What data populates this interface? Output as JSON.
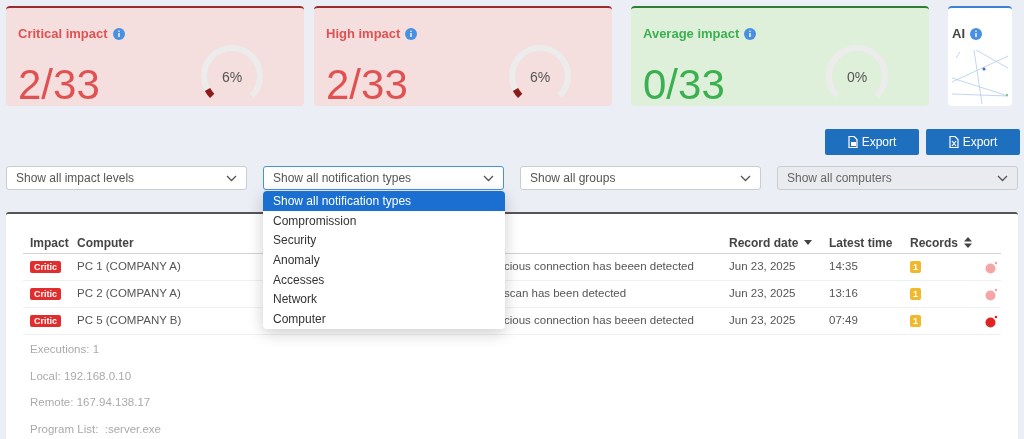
{
  "cards": [
    {
      "kind": "critical",
      "title": "Critical impact",
      "value": "2/33",
      "percent": "6%",
      "level": 0.06
    },
    {
      "kind": "high",
      "title": "High impact",
      "value": "2/33",
      "percent": "6%",
      "level": 0.06
    },
    {
      "kind": "average",
      "title": "Average impact",
      "value": "0/33",
      "percent": "0%"
    },
    {
      "kind": "ai",
      "title": "AI"
    }
  ],
  "export_buttons": [
    {
      "kind": "pdf",
      "label": "Export"
    },
    {
      "kind": "excel",
      "label": "Export"
    }
  ],
  "filters": [
    {
      "value": "Show all impact levels",
      "disabled": false,
      "expanded": false
    },
    {
      "value": "Show all notification types",
      "disabled": false,
      "expanded": true,
      "options": [
        {
          "label": "Show all notification types",
          "selected": true
        },
        {
          "label": "Compromission",
          "selected": false
        },
        {
          "label": "Security",
          "selected": false
        },
        {
          "label": "Anomaly",
          "selected": false
        },
        {
          "label": "Accesses",
          "selected": false
        },
        {
          "label": "Network",
          "selected": false
        },
        {
          "label": "Computer",
          "selected": false
        }
      ]
    },
    {
      "value": "Show all groups",
      "disabled": false,
      "expanded": false
    },
    {
      "value": "Show all computers",
      "disabled": true,
      "expanded": false
    }
  ],
  "table": {
    "columns": [
      {
        "label": "Impact",
        "kind": "plain"
      },
      {
        "label": "Computer",
        "kind": "plain"
      },
      {
        "label": "Record date",
        "kind": "descending"
      },
      {
        "label": "Latest time",
        "kind": "plain"
      },
      {
        "label": "Records",
        "kind": "sortable"
      }
    ],
    "rows": [
      {
        "impact": "Critic",
        "computer": "PC 1 (COMPANY A)",
        "message": "cious connection has beeen detected",
        "date": "Jun 23, 2025",
        "time": "14:35",
        "records": "1",
        "color": "#f4a6a6"
      },
      {
        "impact": "Critic",
        "computer": "PC 2 (COMPANY A)",
        "message": "scan has been detected",
        "date": "Jun 23, 2025",
        "time": "13:16",
        "records": "1",
        "color": "#f4a6a6"
      },
      {
        "impact": "Critic",
        "computer": "PC 5 (COMPANY B)",
        "message": "cious connection has beeen detected",
        "date": "Jun 23, 2025",
        "time": "07:49",
        "records": "1",
        "color": "#e02424"
      }
    ],
    "details": [
      "Executions: 1",
      "Local: 192.168.0.10",
      "Remote: 167.94.138.17",
      "Program List:  :server.exe"
    ]
  }
}
